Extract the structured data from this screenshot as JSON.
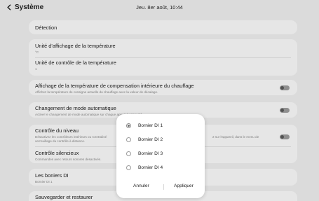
{
  "header": {
    "back_label": "Système",
    "clock": "Jeu. 8er août, 10:44"
  },
  "settings": {
    "detection": {
      "title": "Détection"
    },
    "unit_display": {
      "title": "Unité d'affichage de la température",
      "value": "°C"
    },
    "unit_control": {
      "title": "Unité de contrôle de la température",
      "value": "1"
    },
    "compensation": {
      "title": "Affichage de la température de compensation intérieure du chauffage",
      "subtitle": "Affichez la température de consigne actuelle du chauffage avec la valeur de décalage.",
      "toggle_on": false
    },
    "auto_mode": {
      "title": "Changement de mode automatique",
      "subtitle": "Activer le changement de mode automatique sur chaque appareil connecté.",
      "toggle_on": false
    },
    "level_control": {
      "title": "Contrôle du niveau",
      "subtitle_line1": "Désactivez les contrôleurs intérieurs ou Centralisé",
      "subtitle_line1_right": "2 sur l'appareil, dans le menu de",
      "subtitle_line2": "verrouillage du contrôle à distance.",
      "toggle_on": false
    },
    "silent_control": {
      "title": "Contrôle silencieux",
      "subtitle": "Commandes avec retours sonores désactivés."
    },
    "di_terminals": {
      "title": "Les boniers DI",
      "value": "Bornier DI 1"
    },
    "backup": {
      "title": "Sauvegarder et restaurer"
    }
  },
  "dialog": {
    "options": [
      {
        "label": "Bornier DI 1",
        "selected": true
      },
      {
        "label": "Bornier DI 2",
        "selected": false
      },
      {
        "label": "Bornier DI 3",
        "selected": false
      },
      {
        "label": "Bornier DI 4",
        "selected": false
      }
    ],
    "cancel_label": "Annuler",
    "apply_label": "Appliquer"
  },
  "colors": {
    "background": "#eeeeee",
    "card": "#fafafa",
    "toggle_off": "#9c9c9c"
  }
}
